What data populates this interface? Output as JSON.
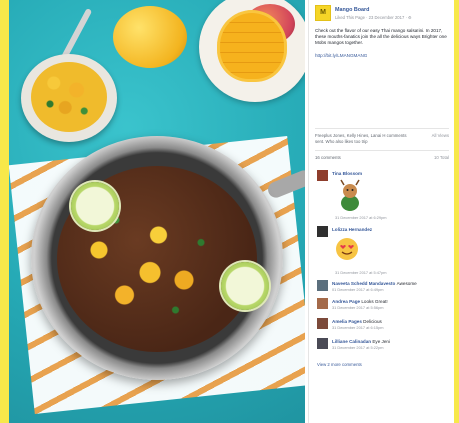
{
  "page": {
    "name": "Mango Board",
    "meta": "Liked This Page · 23 December 2017 · ⚙",
    "avatar_letter": "M",
    "accent": "#f7e84a"
  },
  "post": {
    "text": "Check out the flavor of our easy Thai mango salsa!ini. In 2017, these mouths-fanatics join the all the delicious ways Brighter one Mobs mangos together.",
    "hashtag": "http://bit.ly/LMANGMANG"
  },
  "reactions": {
    "summary": "Freeplus Jones, Kelly Hines, Lanai H comments sent. Who also likes too trip",
    "comments_label": "16 comments",
    "sort_label": "All Views",
    "more_label": "10 Total"
  },
  "comments": [
    {
      "name": "Tina Blossom",
      "text": "",
      "meta": "31 December 2017 at 6:29pm",
      "sticker": "deer-sticker"
    },
    {
      "name": "Lolizza Hernandez",
      "text": "",
      "meta": "31 December 2017 at 5:47pm",
      "sticker": "heart-eyes-emoji"
    },
    {
      "name": "Naveeta Schedd Mandavesto",
      "text": "Awesome",
      "meta": "01 December 2017 at 6:49pm"
    },
    {
      "name": "Andrea Page",
      "text": "Looks Great!",
      "meta": "31 December 2017 at 5:56pm"
    },
    {
      "name": "Amelia Pages",
      "text": "Delicious",
      "meta": "31 December 2017 at 6:15pm"
    },
    {
      "name": "Lilliane Calinadan",
      "text": "Eye Jeni",
      "meta": "31 December 2017 at 5:22pm"
    }
  ],
  "footer": {
    "view_more": "View 2 more comments"
  }
}
